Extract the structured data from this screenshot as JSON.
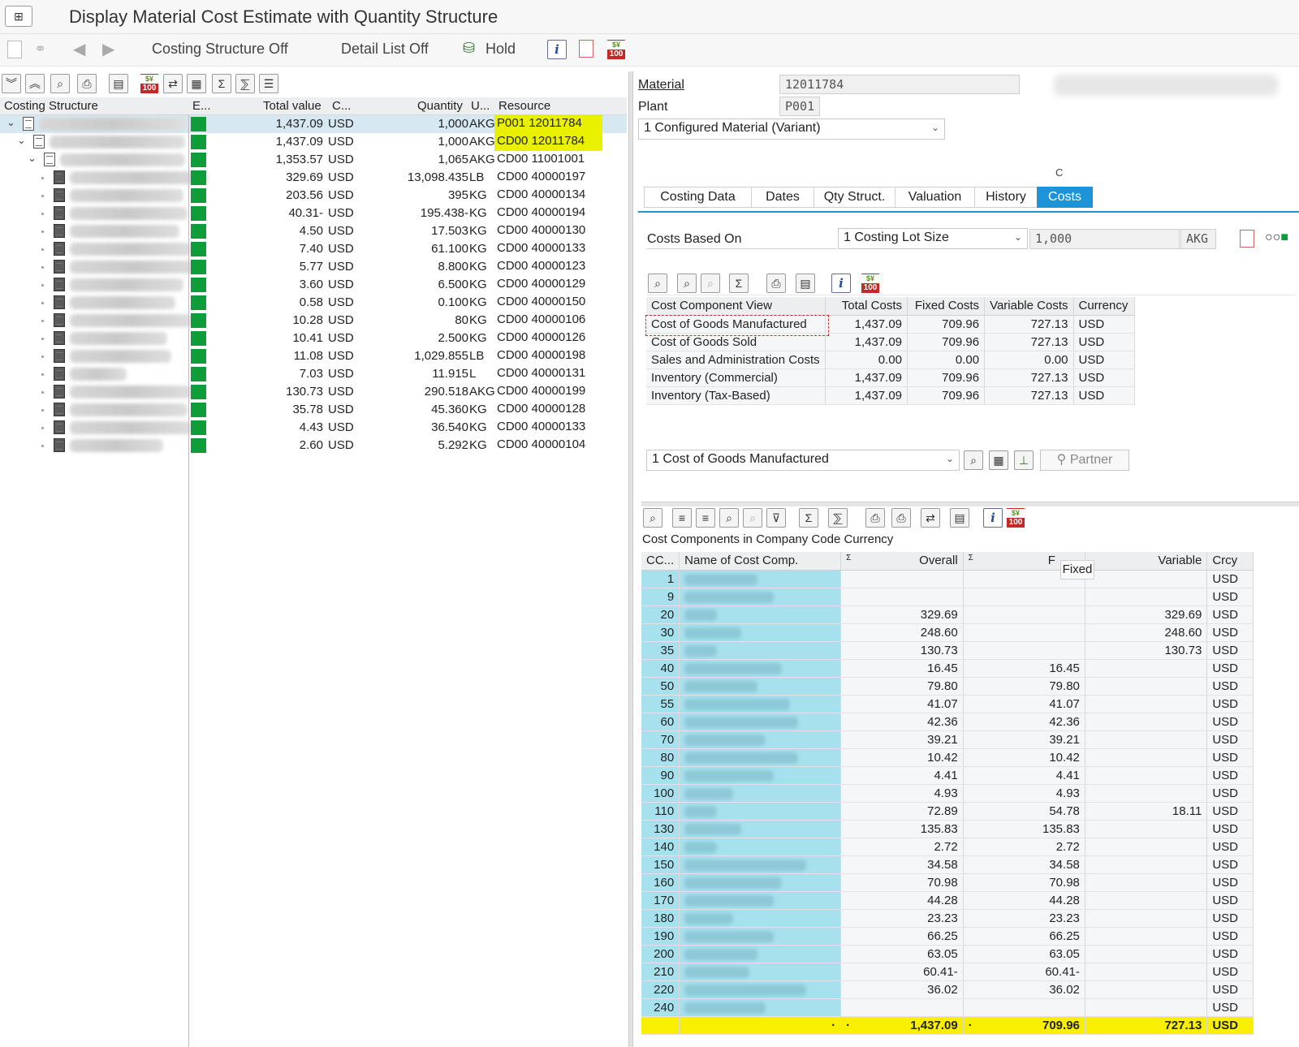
{
  "window": {
    "title": "Display Material Cost Estimate with Quantity Structure"
  },
  "toolbar": {
    "costing_structure_off": "Costing Structure Off",
    "detail_list_off": "Detail List Off",
    "hold": "Hold"
  },
  "tree": {
    "columns": [
      "Costing Structure",
      "E...",
      "Total value",
      "C...",
      "Quantity",
      "U...",
      "Resource"
    ],
    "rows": [
      {
        "total": "1,437.09",
        "cur": "USD",
        "qty": "1,000",
        "unit": "AKG",
        "resource": "P001 12011784"
      },
      {
        "total": "1,437.09",
        "cur": "USD",
        "qty": "1,000",
        "unit": "AKG",
        "resource": "CD00 12011784"
      },
      {
        "total": "1,353.57",
        "cur": "USD",
        "qty": "1,065",
        "unit": "AKG",
        "resource": "CD00 11001001"
      },
      {
        "total": "329.69",
        "cur": "USD",
        "qty": "13,098.435",
        "unit": "LB",
        "resource": "CD00 40000197"
      },
      {
        "total": "203.56",
        "cur": "USD",
        "qty": "395",
        "unit": "KG",
        "resource": "CD00 40000134"
      },
      {
        "total": "40.31-",
        "cur": "USD",
        "qty": "195.438-",
        "unit": "KG",
        "resource": "CD00 40000194"
      },
      {
        "total": "4.50",
        "cur": "USD",
        "qty": "17.503",
        "unit": "KG",
        "resource": "CD00 40000130"
      },
      {
        "total": "7.40",
        "cur": "USD",
        "qty": "61.100",
        "unit": "KG",
        "resource": "CD00 40000133"
      },
      {
        "total": "5.77",
        "cur": "USD",
        "qty": "8.800",
        "unit": "KG",
        "resource": "CD00 40000123"
      },
      {
        "total": "3.60",
        "cur": "USD",
        "qty": "6.500",
        "unit": "KG",
        "resource": "CD00 40000129"
      },
      {
        "total": "0.58",
        "cur": "USD",
        "qty": "0.100",
        "unit": "KG",
        "resource": "CD00 40000150"
      },
      {
        "total": "10.28",
        "cur": "USD",
        "qty": "80",
        "unit": "KG",
        "resource": "CD00 40000106"
      },
      {
        "total": "10.41",
        "cur": "USD",
        "qty": "2.500",
        "unit": "KG",
        "resource": "CD00 40000126"
      },
      {
        "total": "11.08",
        "cur": "USD",
        "qty": "1,029.855",
        "unit": "LB",
        "resource": "CD00 40000198"
      },
      {
        "total": "7.03",
        "cur": "USD",
        "qty": "11.915",
        "unit": "L",
        "resource": "CD00 40000131"
      },
      {
        "total": "130.73",
        "cur": "USD",
        "qty": "290.518",
        "unit": "AKG",
        "resource": "CD00 40000199"
      },
      {
        "total": "35.78",
        "cur": "USD",
        "qty": "45.360",
        "unit": "KG",
        "resource": "CD00 40000128"
      },
      {
        "total": "4.43",
        "cur": "USD",
        "qty": "36.540",
        "unit": "KG",
        "resource": "CD00 40000133"
      },
      {
        "total": "2.60",
        "cur": "USD",
        "qty": "5.292",
        "unit": "KG",
        "resource": "CD00 40000104"
      }
    ]
  },
  "header": {
    "material_label": "Material",
    "material_value": "12011784",
    "plant_label": "Plant",
    "plant_value": "P001",
    "variant_select": "1 Configured Material (Variant)",
    "c_marker": "C"
  },
  "tabs": [
    "Costing Data",
    "Dates",
    "Qty Struct.",
    "Valuation",
    "History",
    "Costs"
  ],
  "costs": {
    "based_on_label": "Costs Based On",
    "based_on_select": "1 Costing Lot Size",
    "lot_size": "1,000",
    "lot_unit": "AKG",
    "view_columns": [
      "Cost Component View",
      "Total Costs",
      "Fixed Costs",
      "Variable Costs",
      "Currency"
    ],
    "views": [
      {
        "name": "Cost of Goods Manufactured",
        "total": "1,437.09",
        "fixed": "709.96",
        "variable": "727.13",
        "cur": "USD"
      },
      {
        "name": "Cost of Goods Sold",
        "total": "1,437.09",
        "fixed": "709.96",
        "variable": "727.13",
        "cur": "USD"
      },
      {
        "name": "Sales and Administration Costs",
        "total": "0.00",
        "fixed": "0.00",
        "variable": "0.00",
        "cur": "USD"
      },
      {
        "name": "Inventory (Commercial)",
        "total": "1,437.09",
        "fixed": "709.96",
        "variable": "727.13",
        "cur": "USD"
      },
      {
        "name": "Inventory (Tax-Based)",
        "total": "1,437.09",
        "fixed": "709.96",
        "variable": "727.13",
        "cur": "USD"
      }
    ],
    "view_select": "1 Cost of Goods Manufactured",
    "partner_label": "Partner"
  },
  "components": {
    "title": "Cost Components in Company Code Currency",
    "columns": [
      "CC...",
      "Name of Cost Comp.",
      "Overall",
      "F",
      "Variable",
      "Crcy"
    ],
    "tooltip": "Fixed",
    "rows": [
      {
        "cc": "1",
        "overall": "",
        "fixed": "",
        "variable": "",
        "crcy": "USD"
      },
      {
        "cc": "9",
        "overall": "",
        "fixed": "",
        "variable": "",
        "crcy": "USD"
      },
      {
        "cc": "20",
        "overall": "329.69",
        "fixed": "",
        "variable": "329.69",
        "crcy": "USD"
      },
      {
        "cc": "30",
        "overall": "248.60",
        "fixed": "",
        "variable": "248.60",
        "crcy": "USD"
      },
      {
        "cc": "35",
        "overall": "130.73",
        "fixed": "",
        "variable": "130.73",
        "crcy": "USD"
      },
      {
        "cc": "40",
        "overall": "16.45",
        "fixed": "16.45",
        "variable": "",
        "crcy": "USD"
      },
      {
        "cc": "50",
        "overall": "79.80",
        "fixed": "79.80",
        "variable": "",
        "crcy": "USD"
      },
      {
        "cc": "55",
        "overall": "41.07",
        "fixed": "41.07",
        "variable": "",
        "crcy": "USD"
      },
      {
        "cc": "60",
        "overall": "42.36",
        "fixed": "42.36",
        "variable": "",
        "crcy": "USD"
      },
      {
        "cc": "70",
        "overall": "39.21",
        "fixed": "39.21",
        "variable": "",
        "crcy": "USD"
      },
      {
        "cc": "80",
        "overall": "10.42",
        "fixed": "10.42",
        "variable": "",
        "crcy": "USD"
      },
      {
        "cc": "90",
        "overall": "4.41",
        "fixed": "4.41",
        "variable": "",
        "crcy": "USD"
      },
      {
        "cc": "100",
        "overall": "4.93",
        "fixed": "4.93",
        "variable": "",
        "crcy": "USD"
      },
      {
        "cc": "110",
        "overall": "72.89",
        "fixed": "54.78",
        "variable": "18.11",
        "crcy": "USD"
      },
      {
        "cc": "130",
        "overall": "135.83",
        "fixed": "135.83",
        "variable": "",
        "crcy": "USD"
      },
      {
        "cc": "140",
        "overall": "2.72",
        "fixed": "2.72",
        "variable": "",
        "crcy": "USD"
      },
      {
        "cc": "150",
        "overall": "34.58",
        "fixed": "34.58",
        "variable": "",
        "crcy": "USD"
      },
      {
        "cc": "160",
        "overall": "70.98",
        "fixed": "70.98",
        "variable": "",
        "crcy": "USD"
      },
      {
        "cc": "170",
        "overall": "44.28",
        "fixed": "44.28",
        "variable": "",
        "crcy": "USD"
      },
      {
        "cc": "180",
        "overall": "23.23",
        "fixed": "23.23",
        "variable": "",
        "crcy": "USD"
      },
      {
        "cc": "190",
        "overall": "66.25",
        "fixed": "66.25",
        "variable": "",
        "crcy": "USD"
      },
      {
        "cc": "200",
        "overall": "63.05",
        "fixed": "63.05",
        "variable": "",
        "crcy": "USD"
      },
      {
        "cc": "210",
        "overall": "60.41-",
        "fixed": "60.41-",
        "variable": "",
        "crcy": "USD"
      },
      {
        "cc": "220",
        "overall": "36.02",
        "fixed": "36.02",
        "variable": "",
        "crcy": "USD"
      },
      {
        "cc": "240",
        "overall": "",
        "fixed": "",
        "variable": "",
        "crcy": "USD"
      }
    ],
    "totals": {
      "overall": "1,437.09",
      "fixed": "709.96",
      "variable": "727.13",
      "crcy": "USD",
      "dot": "·"
    }
  }
}
